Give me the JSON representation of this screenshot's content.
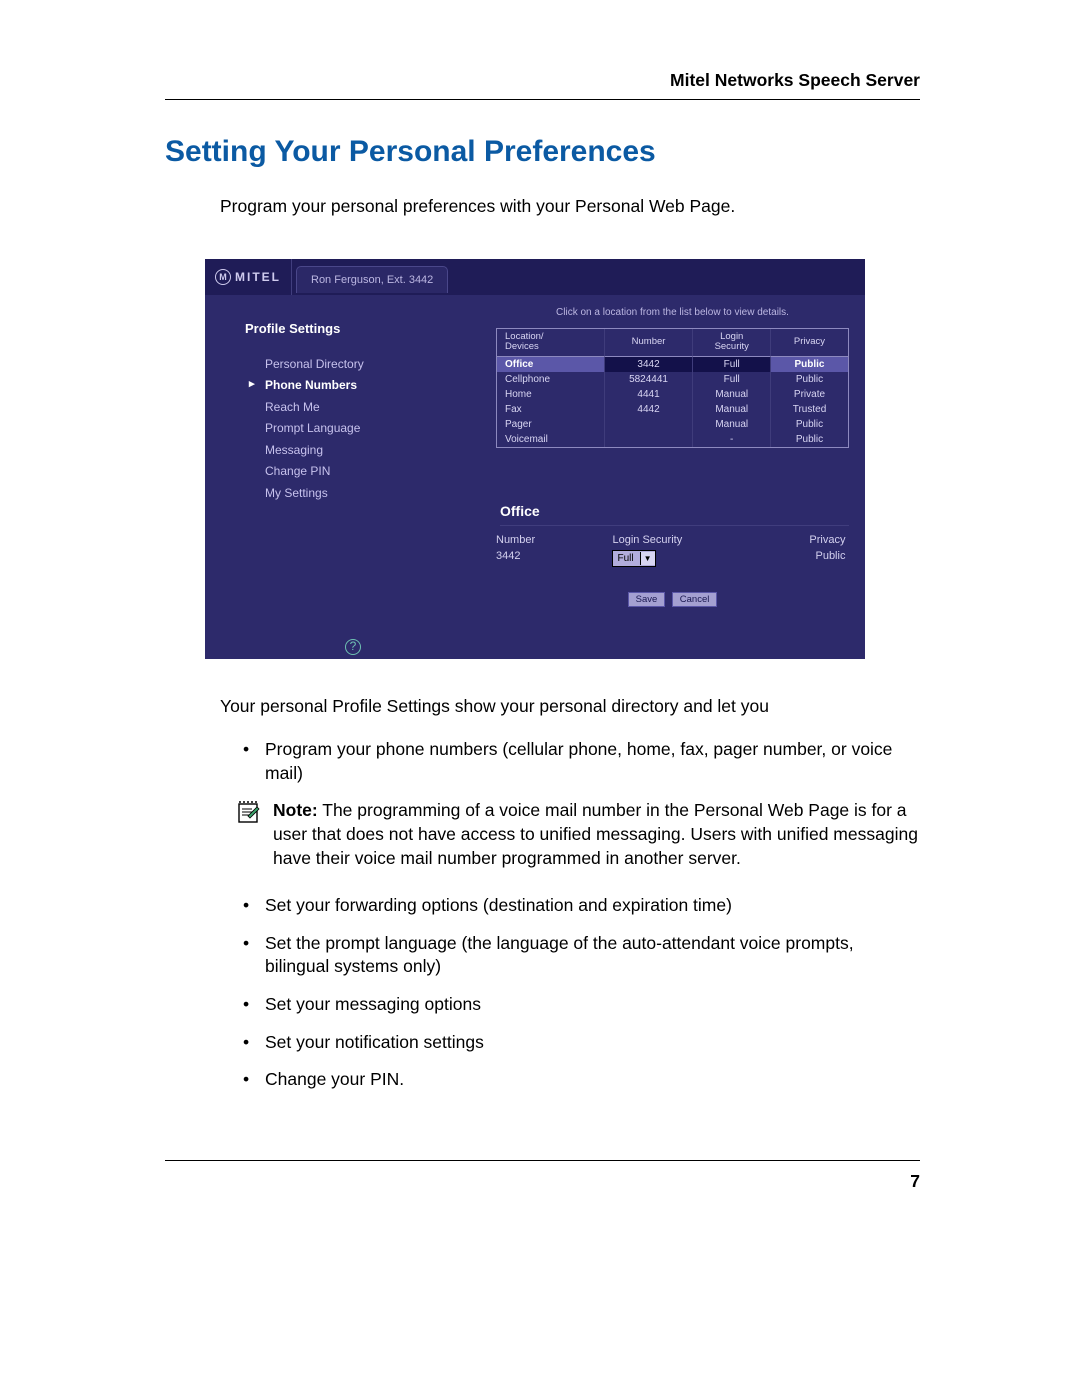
{
  "header": {
    "running_title": "Mitel Networks Speech Server"
  },
  "title": "Setting Your Personal Preferences",
  "intro": "Program your personal preferences with your Personal Web Page.",
  "screenshot": {
    "logo_text": "MITEL",
    "user_tab": "Ron Ferguson, Ext. 3442",
    "sidebar_title": "Profile Settings",
    "nav": [
      {
        "label": "Personal Directory",
        "active": false
      },
      {
        "label": "Phone Numbers",
        "active": true
      },
      {
        "label": "Reach Me",
        "active": false
      },
      {
        "label": "Prompt Language",
        "active": false
      },
      {
        "label": "Messaging",
        "active": false
      },
      {
        "label": "Change PIN",
        "active": false
      },
      {
        "label": "My Settings",
        "active": false
      }
    ],
    "instruction": "Click on a location from the list below to view details.",
    "table": {
      "headers": [
        "Location/\nDevices",
        "Number",
        "Login\nSecurity",
        "Privacy"
      ],
      "rows": [
        {
          "cells": [
            "Office",
            "3442",
            "Full",
            "Public"
          ],
          "selected": true
        },
        {
          "cells": [
            "Cellphone",
            "5824441",
            "Full",
            "Public"
          ],
          "selected": false
        },
        {
          "cells": [
            "Home",
            "4441",
            "Manual",
            "Private"
          ],
          "selected": false
        },
        {
          "cells": [
            "Fax",
            "4442",
            "Manual",
            "Trusted"
          ],
          "selected": false
        },
        {
          "cells": [
            "Pager",
            "",
            "Manual",
            "Public"
          ],
          "selected": false
        },
        {
          "cells": [
            "Voicemail",
            "",
            "-",
            "Public"
          ],
          "selected": false
        }
      ]
    },
    "detail": {
      "title": "Office",
      "number_label": "Number",
      "number_value": "3442",
      "login_label": "Login Security",
      "login_value": "Full",
      "privacy_label": "Privacy",
      "privacy_value": "Public"
    },
    "buttons": {
      "save": "Save",
      "cancel": "Cancel"
    },
    "help_glyph": "?"
  },
  "after_shot": "Your personal Profile Settings show your personal directory and let you",
  "bullets_a": [
    "Program your phone numbers (cellular phone, home, fax, pager number, or voice mail)"
  ],
  "note": {
    "label": "Note:",
    "text": " The programming of a voice mail number in the Personal Web Page is for a user that does not have access to unified messaging. Users with unified messaging have their voice mail number programmed in another server."
  },
  "bullets_b": [
    "Set your forwarding options (destination and expiration time)",
    "Set the prompt language (the language of the auto-attendant voice prompts, bilingual systems only)",
    "Set your messaging options",
    "Set your notification settings",
    "Change your PIN."
  ],
  "page_number": "7"
}
